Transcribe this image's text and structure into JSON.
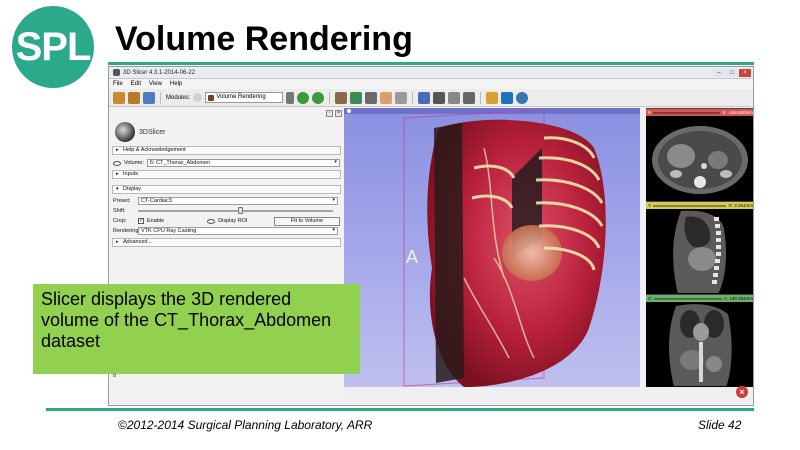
{
  "slide": {
    "logo_text": "SPL",
    "title": "Volume Rendering",
    "caption": "Slicer displays the 3D rendered volume of the CT_Thorax_Abdomen dataset",
    "copyright": "©2012-2014 Surgical Planning Laboratory, ARR",
    "slide_number": "Slide 42"
  },
  "window": {
    "title": "3D Slicer 4.3.1-2014-06-22",
    "menu": [
      "File",
      "Edit",
      "View",
      "Help"
    ],
    "modules_label": "Modules:",
    "module_value": "Volume Rendering"
  },
  "panel": {
    "brand": "3DSlicer",
    "help_section": "Help & Acknowledgement",
    "volume_label": "Volume:",
    "volume_value": "6: CT_Thorax_Abdomen",
    "inputs_section": "Inputs",
    "display_section": "Display",
    "preset_label": "Preset:",
    "preset_value": "CT-Cardiac3",
    "shift_label": "Shift:",
    "crop_label": "Crop:",
    "enable_label": "Enable",
    "display_roi_label": "Display ROI",
    "fit_button": "Fit to Volume",
    "rendering_label": "Rendering:",
    "rendering_value": "VTK CPU Ray Casting",
    "advanced_section": "Advanced...",
    "footer_letter": "B"
  },
  "view3d": {
    "orientation_label": "A"
  },
  "slices": [
    {
      "color": "red",
      "letter": "R",
      "value": "S: -188.500mm"
    },
    {
      "color": "yellow",
      "letter": "Y",
      "value": "R: 3.254mm"
    },
    {
      "color": "green",
      "letter": "G",
      "value": "A: 109.254mm"
    }
  ],
  "colors": {
    "brand_green": "#2aa98b",
    "caption_green": "#92d050",
    "view3d_background": "#a3a7ea"
  }
}
